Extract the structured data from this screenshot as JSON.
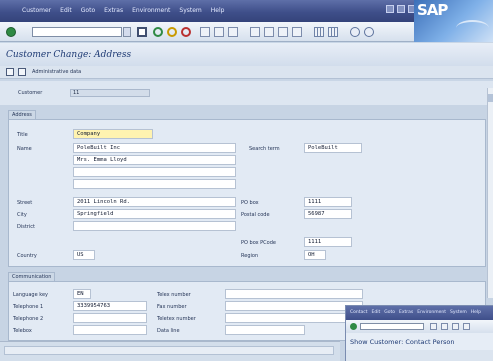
{
  "menu": {
    "items": [
      "Customer",
      "Edit",
      "Goto",
      "Extras",
      "Environment",
      "System",
      "Help"
    ]
  },
  "brand": {
    "logo_text": "SAP"
  },
  "page": {
    "title": "Customer Change: Address"
  },
  "app_toolbar": {
    "button_label": "Administrative data"
  },
  "customer": {
    "label": "Customer",
    "value": "11"
  },
  "address": {
    "frame_title": "Address",
    "title_label": "Title",
    "title_value": "Company",
    "name_label": "Name",
    "name_values": [
      "PoleBuilt Inc",
      "Mrs. Emma Lloyd",
      "",
      ""
    ],
    "search_label": "Search term",
    "search_value": "PoleBuilt",
    "street_label": "Street",
    "street_value": "2011 Lincoln Rd.",
    "city_label": "City",
    "city_value": "Springfield",
    "district_label": "District",
    "district_value": "",
    "pobox_label": "PO box",
    "pobox_value": "1111",
    "postal_label": "Postal code",
    "postal_value": "56987",
    "country_label": "Country",
    "country_value": "US",
    "pobox_pc_label": "PO box PCode",
    "pobox_pc_value": "1111",
    "region_label": "Region",
    "region_value": "OH"
  },
  "communication": {
    "frame_title": "Communication",
    "language_label": "Language key",
    "language_value": "EN",
    "tel1_label": "Telephone 1",
    "tel1_value": "3339954763",
    "tel2_label": "Telephone 2",
    "tel2_value": "",
    "telebox_label": "Telebox",
    "telebox_value": "",
    "telex_label": "Telex number",
    "telex_value": "",
    "fax_label": "Fax number",
    "fax_value": "",
    "teletex_label": "Teletex number",
    "teletex_value": "",
    "dataline_label": "Data line",
    "dataline_value": ""
  },
  "overlay": {
    "menu_items": [
      "Contact",
      "Edit",
      "Goto",
      "Extras",
      "Environment",
      "System",
      "Help"
    ],
    "title": "Show Customer: Contact Person"
  }
}
